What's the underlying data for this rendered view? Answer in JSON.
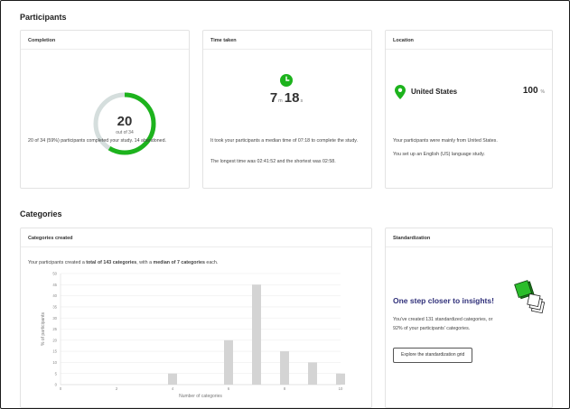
{
  "participants": {
    "title": "Participants",
    "completion": {
      "title": "Completion",
      "count": "20",
      "out_of": "out of 34",
      "fraction": 0.588,
      "description": "20 of 34 (59%) participants completed your study. 14 abandoned.",
      "ring_color": "#1db31d"
    },
    "time_taken": {
      "title": "Time taken",
      "minutes": "7",
      "minutes_unit": "m",
      "seconds": "18",
      "seconds_unit": "s",
      "median_text": "It took your participants a median time of 07:18 to complete the study.",
      "range_text": "The longest time was 02:41:52 and the shortest was 02:58."
    },
    "location": {
      "title": "Location",
      "country": "United States",
      "percent": "100",
      "percent_unit": "%",
      "text_mainly": "Your participants were mainly from United States.",
      "text_language": "You set up an English (US) language study."
    }
  },
  "categories": {
    "title": "Categories",
    "created": {
      "title": "Categories created",
      "summary_prefix": "Your participants created a ",
      "summary_total": "total of 143 categories",
      "summary_mid": ", with a ",
      "summary_median": "median of 7 categories",
      "summary_suffix": " each."
    },
    "standardization": {
      "title": "Standardization",
      "headline": "One step closer to insights!",
      "text_line1": "You've created 131 standardized categories, or",
      "text_line2": "92% of your participants' categories.",
      "button": "Explore the standardization grid"
    }
  },
  "chart_data": {
    "type": "bar",
    "x": [
      4,
      6,
      7,
      8,
      9,
      10
    ],
    "values": [
      5,
      20,
      45,
      15,
      10,
      5
    ],
    "xlabel": "Number of categories",
    "ylabel": "% of participants",
    "xlim": [
      0,
      10
    ],
    "ylim": [
      0,
      50
    ],
    "xticks": [
      "0",
      "2",
      "4",
      "6",
      "8",
      "10"
    ],
    "yticks": [
      "0",
      "5",
      "10",
      "15",
      "20",
      "25",
      "30",
      "35",
      "40",
      "45",
      "50"
    ],
    "grid": true,
    "bar_color": "#d4d4d4"
  }
}
